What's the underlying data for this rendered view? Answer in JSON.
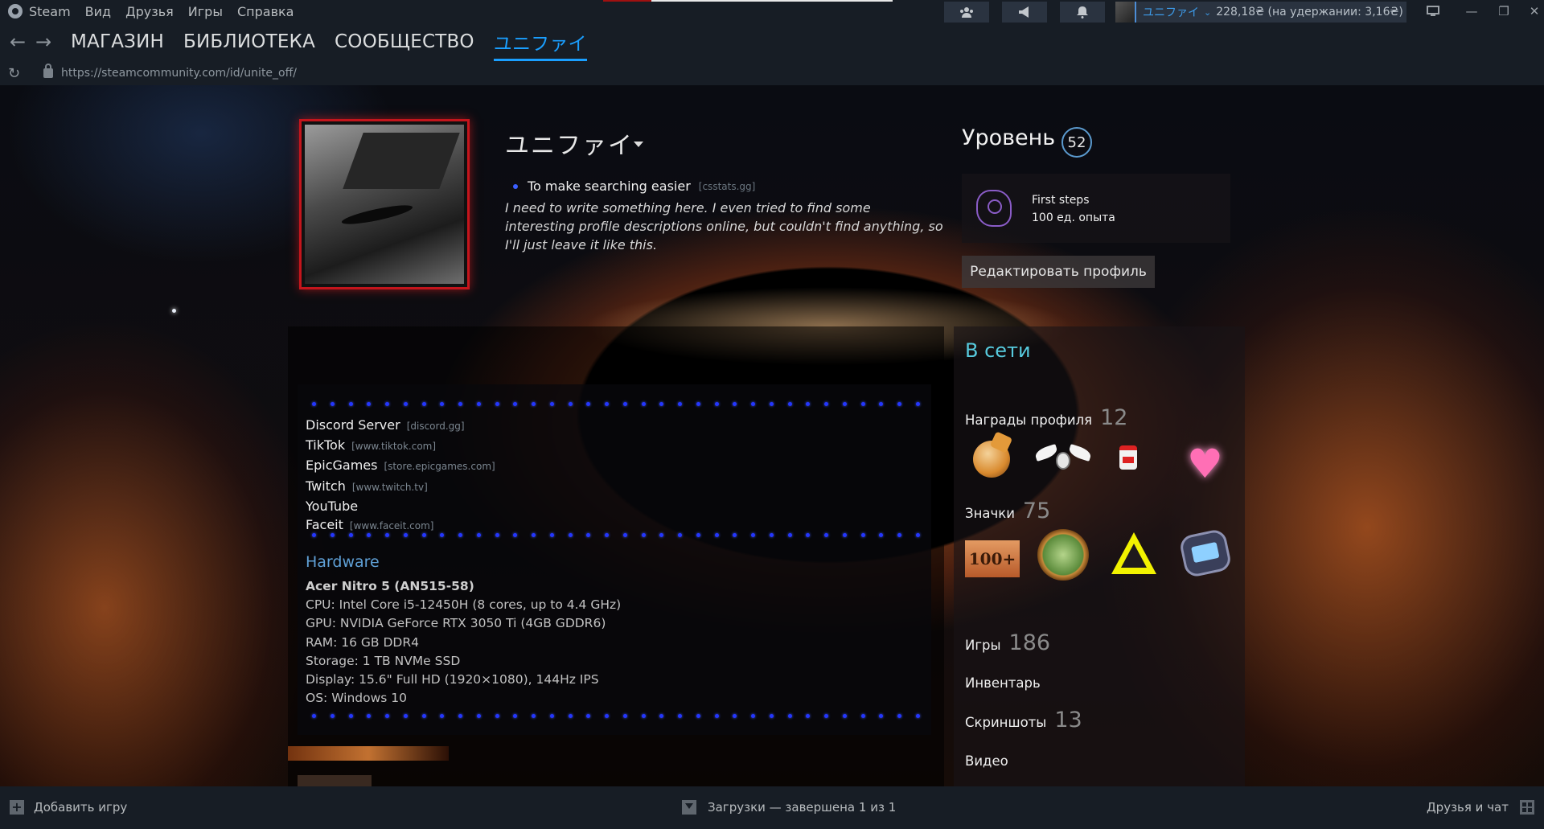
{
  "menu": {
    "app_name": "Steam",
    "items": [
      "Вид",
      "Друзья",
      "Игры",
      "Справка"
    ]
  },
  "titlebar": {
    "friends_icon": "friends-icon",
    "announcement_icon": "megaphone-icon",
    "notification_icon": "bell-icon",
    "account_name": "ユニファイ",
    "wallet": "228,18₴ (на удержании: 3,16₴)",
    "bigpicture_icon": "monitor-icon",
    "minimize": "—",
    "maximize": "❐",
    "close": "✕"
  },
  "nav": {
    "back": "←",
    "forward": "→",
    "tabs": [
      "МАГАЗИН",
      "БИБЛИОТЕКА",
      "СООБЩЕСТВО",
      "ユニファイ"
    ],
    "refresh": "↻",
    "url": "https://steamcommunity.com/id/unite_off/"
  },
  "profile": {
    "persona_name": "ユニファイ",
    "summary_link_text": "To make searching easier",
    "summary_link_host": "[csstats.gg]",
    "bio": "I need to write something here. I even tried to find some interesting profile descriptions online, but couldn't find anything, so I'll just leave it like this.",
    "level_label": "Уровень",
    "level": "52",
    "xp_badge_title": "First steps",
    "xp_badge_sub": "100 ед. опыта",
    "edit_profile": "Редактировать профиль"
  },
  "showcase": {
    "links": [
      {
        "name": "Discord Server",
        "host": "[discord.gg]"
      },
      {
        "name": "TikTok",
        "host": "[www.tiktok.com]"
      },
      {
        "name": "EpicGames",
        "host": "[store.epicgames.com]"
      },
      {
        "name": "Twitch",
        "host": "[www.twitch.tv]"
      },
      {
        "name": "YouTube",
        "host": ""
      },
      {
        "name": "Faceit",
        "host": "[www.faceit.com]"
      }
    ],
    "hardware_title": "Hardware",
    "hardware": [
      "Acer Nitro 5 (AN515-58)",
      "CPU: Intel Core i5-12450H (8 cores, up to 4.4 GHz)",
      "GPU: NVIDIA GeForce RTX 3050 Ti (4GB GDDR6)",
      "RAM: 16 GB DDR4",
      "Storage: 1 TB NVMe SSD",
      "Display: 15.6\" Full HD (1920×1080), 144Hz IPS",
      "OS: Windows 10"
    ]
  },
  "sidebar": {
    "status": "В сети",
    "awards_label": "Награды профиля",
    "awards_count": "12",
    "badges_label": "Значки",
    "badges_count": "75",
    "badge_100_text": "100+",
    "games_label": "Игры",
    "games_count": "186",
    "inventory_label": "Инвентарь",
    "screenshots_label": "Скриншоты",
    "screenshots_count": "13",
    "videos_label": "Видео"
  },
  "bottombar": {
    "add_game": "Добавить игру",
    "downloads": "Загрузки — завершена 1 из 1",
    "friends_chat": "Друзья и чат"
  },
  "colors": {
    "accent": "#1a9fff",
    "online": "#57cbde",
    "avatar_frame": "#c4151c",
    "divider_dots": "#2436ff"
  }
}
